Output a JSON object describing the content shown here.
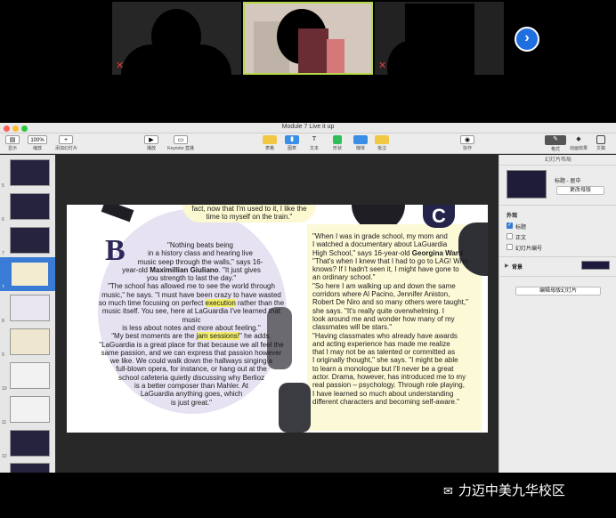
{
  "window": {
    "title": "Module 7 Live it up"
  },
  "toolbar": {
    "items": [
      {
        "label": "显示",
        "icon": "sidebar-view-icon"
      },
      {
        "label": "缩放",
        "value": "100%",
        "icon": "zoom-icon"
      },
      {
        "label": "添加幻灯片",
        "icon": "plus-icon"
      },
      {
        "label": "播放",
        "icon": "play-icon"
      },
      {
        "label": "Keynote 直播",
        "icon": "live-icon"
      },
      {
        "label": "表格",
        "icon": "table-icon"
      },
      {
        "label": "图表",
        "icon": "chart-icon"
      },
      {
        "label": "文本",
        "icon": "text-icon"
      },
      {
        "label": "形状",
        "icon": "shape-icon"
      },
      {
        "label": "媒体",
        "icon": "media-icon"
      },
      {
        "label": "批注",
        "icon": "comment-icon"
      },
      {
        "label": "协作",
        "icon": "collaborate-icon"
      },
      {
        "label": "格式",
        "icon": "format-icon"
      },
      {
        "label": "动画效果",
        "icon": "animate-icon"
      },
      {
        "label": "文稿",
        "icon": "document-icon"
      }
    ]
  },
  "navigator": {
    "slides": [
      "5",
      "6",
      "7",
      "8",
      "9",
      "10",
      "11",
      "12",
      "13"
    ],
    "selected": "7"
  },
  "inspector": {
    "header": "幻灯片布局",
    "layout_name": "标题 - 居中",
    "change_master": "更改母版",
    "appearance_label": "外观",
    "checks": [
      {
        "label": "标题",
        "checked": true
      },
      {
        "label": "正文",
        "checked": false
      },
      {
        "label": "幻灯片编号",
        "checked": false
      }
    ],
    "background_label": "背景",
    "edit_master": "编辑母版幻灯片"
  },
  "slide": {
    "top_text_1": "fact, now that I'm used to it, I like the",
    "top_text_2": "time to myself on the train.\"",
    "letter_b": "B",
    "letter_c": "C",
    "b_lines": [
      "\"Nothing beats being",
      "in a history class and hearing live",
      "music seep through the walls,\" says 16-",
      "year-old |Maximillian Giuliano|. \"It just gives",
      "you strength to last the day.\"",
      "\"The school has allowed me to see the world through",
      "music,\" he says. \"I must have been crazy to have wasted",
      "so much time focusing on perfect ~execution~ rather than the",
      "music itself. You see, here at LaGuardia I've learned that music",
      "is less about notes and more about feeling.\"",
      "\"My best moments are the ~jam sessions!~\" he adds.",
      "\"LaGuardia is a great place for that because we all feel the",
      "same passion, and we can express that passion however",
      "we like. We could walk down the hallways singing a",
      "full-blown opera, for instance, or hang out at the",
      "school cafeteria quietly discussing why Berlioz",
      "is a better composer than Mahler. At",
      "LaGuardia anything goes, which",
      "is just great.\""
    ],
    "c_lines": [
      "\"When I was in grade school, my mom and",
      "I watched a documentary about LaGuardia",
      "High School,\" says 16-year-old |Georgina Ward|.",
      "\"That's when I knew that I had to go to LAG! Who",
      "knows? If I hadn't seen it, I might have gone to",
      "an ordinary school.\"",
      "\"So here I am walking up and down the same",
      "corridors where Al Pacino, Jennifer Aniston,",
      "Robert De Niro and so many others were taught,\"",
      "she says. \"It's really quite overwhelming. I",
      "look around me and wonder how many of my",
      "classmates will be stars.\"",
      "\"Having classmates who already have awards",
      "and acting experience has made me realize",
      "that I may not be as talented or committed as",
      "I originally thought,\" she says. \"I might be able",
      "to learn a monologue but I'll never be a great",
      "actor. Drama, however, has introduced me to my",
      "real passion – psychology. Through role playing,",
      "I have learned so much about understanding",
      "different characters and becoming self-aware.\""
    ]
  },
  "watermark": "力迈中美九华校区",
  "colors": {
    "accent": "#3a7bd5",
    "highlight": "#f3ef6a",
    "circle": "#e7e2f2",
    "cream": "#fcf9d6",
    "navy": "#2d2a5a"
  }
}
